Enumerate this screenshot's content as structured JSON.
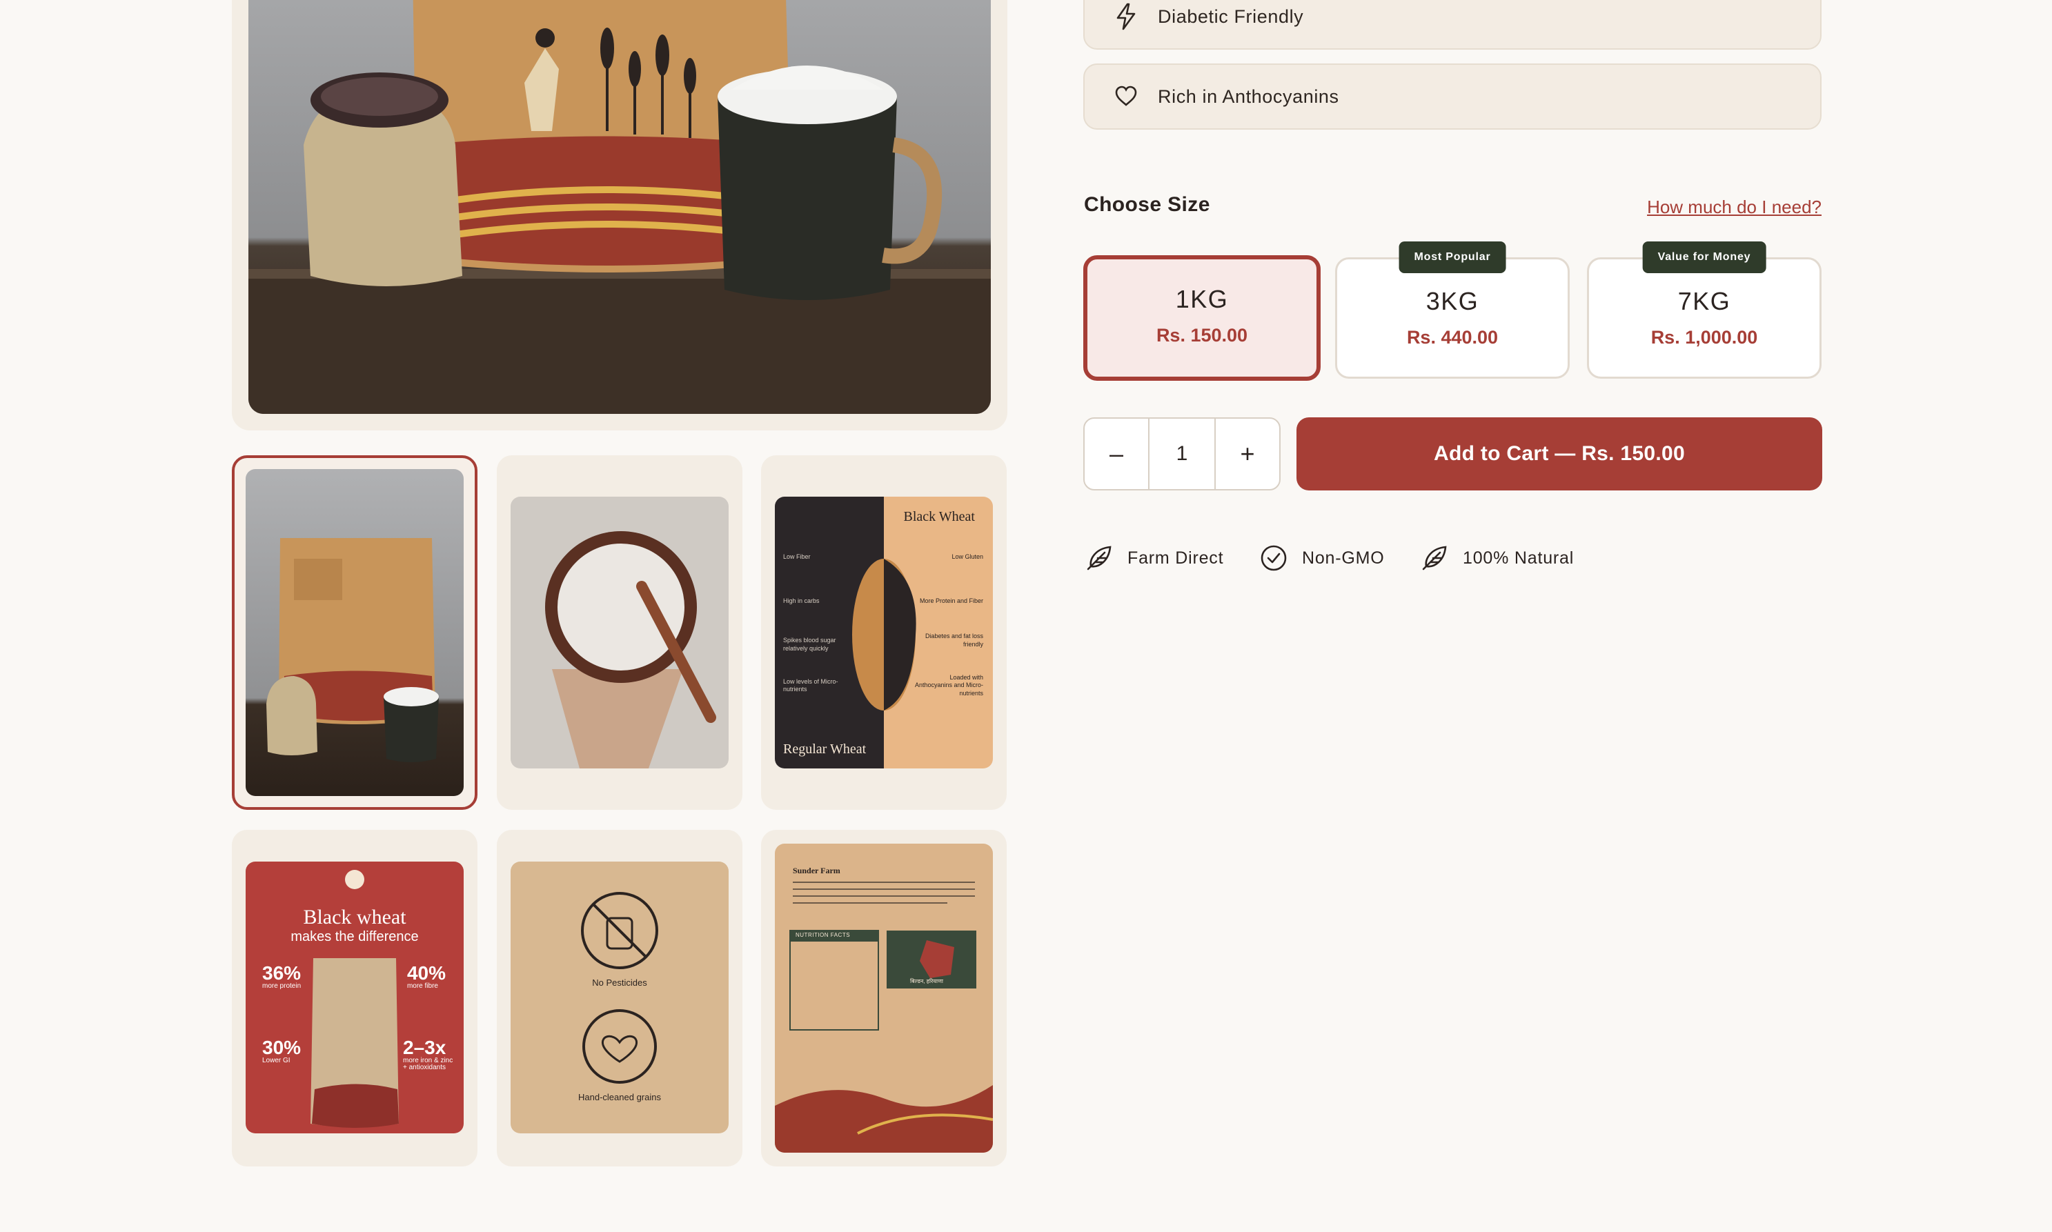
{
  "gallery": {
    "thumbnails": [
      {
        "id": "pack-photo"
      },
      {
        "id": "flour-bowl"
      },
      {
        "id": "grain-comparison",
        "title": "Black Wheat",
        "subtitle": "Regular Wheat",
        "left_notes": [
          "Low Fiber",
          "High in carbs",
          "Spikes blood sugar relatively quickly",
          "Low levels of Micro-nutrients"
        ],
        "right_notes": [
          "Low Gluten",
          "More Protein and Fiber",
          "Diabetes and fat loss friendly",
          "Loaded with Anthocyanins and Micro-nutrients"
        ]
      },
      {
        "id": "difference-poster",
        "title": "Black wheat",
        "subtitle": "makes the difference",
        "stats": [
          {
            "value": "36%",
            "label": "more protein"
          },
          {
            "value": "40%",
            "label": "more fibre"
          },
          {
            "value": "30%",
            "label": "Lower GI"
          },
          {
            "value": "2–3x",
            "label": "more iron & zinc + antioxidants"
          }
        ]
      },
      {
        "id": "icons-card",
        "labels": [
          "No Pesticides",
          "Hand-cleaned grains"
        ]
      },
      {
        "id": "back-label",
        "title": "Sunder Farm",
        "table_title": "NUTRITION FACTS",
        "map_label": "बिल्डन, हरियाणा"
      }
    ]
  },
  "features": [
    {
      "icon": "lightning-icon",
      "label": "Diabetic Friendly"
    },
    {
      "icon": "heart-icon",
      "label": "Rich in Anthocyanins"
    }
  ],
  "size": {
    "title": "Choose Size",
    "help_link": "How much do I need?",
    "options": [
      {
        "weight": "1KG",
        "price": "Rs. 150.00",
        "badge": "",
        "selected": true
      },
      {
        "weight": "3KG",
        "price": "Rs. 440.00",
        "badge": "Most Popular",
        "selected": false
      },
      {
        "weight": "7KG",
        "price": "Rs. 1,000.00",
        "badge": "Value for Money",
        "selected": false
      }
    ]
  },
  "quantity": {
    "minus": "–",
    "value": "1",
    "plus": "+"
  },
  "cart": {
    "label": "Add to Cart — Rs. 150.00"
  },
  "trust_badges": [
    {
      "icon": "feather-icon",
      "label": "Farm Direct"
    },
    {
      "icon": "check-circle-icon",
      "label": "Non-GMO"
    },
    {
      "icon": "feather-icon",
      "label": "100% Natural"
    }
  ],
  "colors": {
    "accent": "#a63e36",
    "badge_bg": "#2f3b2a",
    "card_bg": "#f3ece3",
    "page_bg": "#faf8f5"
  }
}
